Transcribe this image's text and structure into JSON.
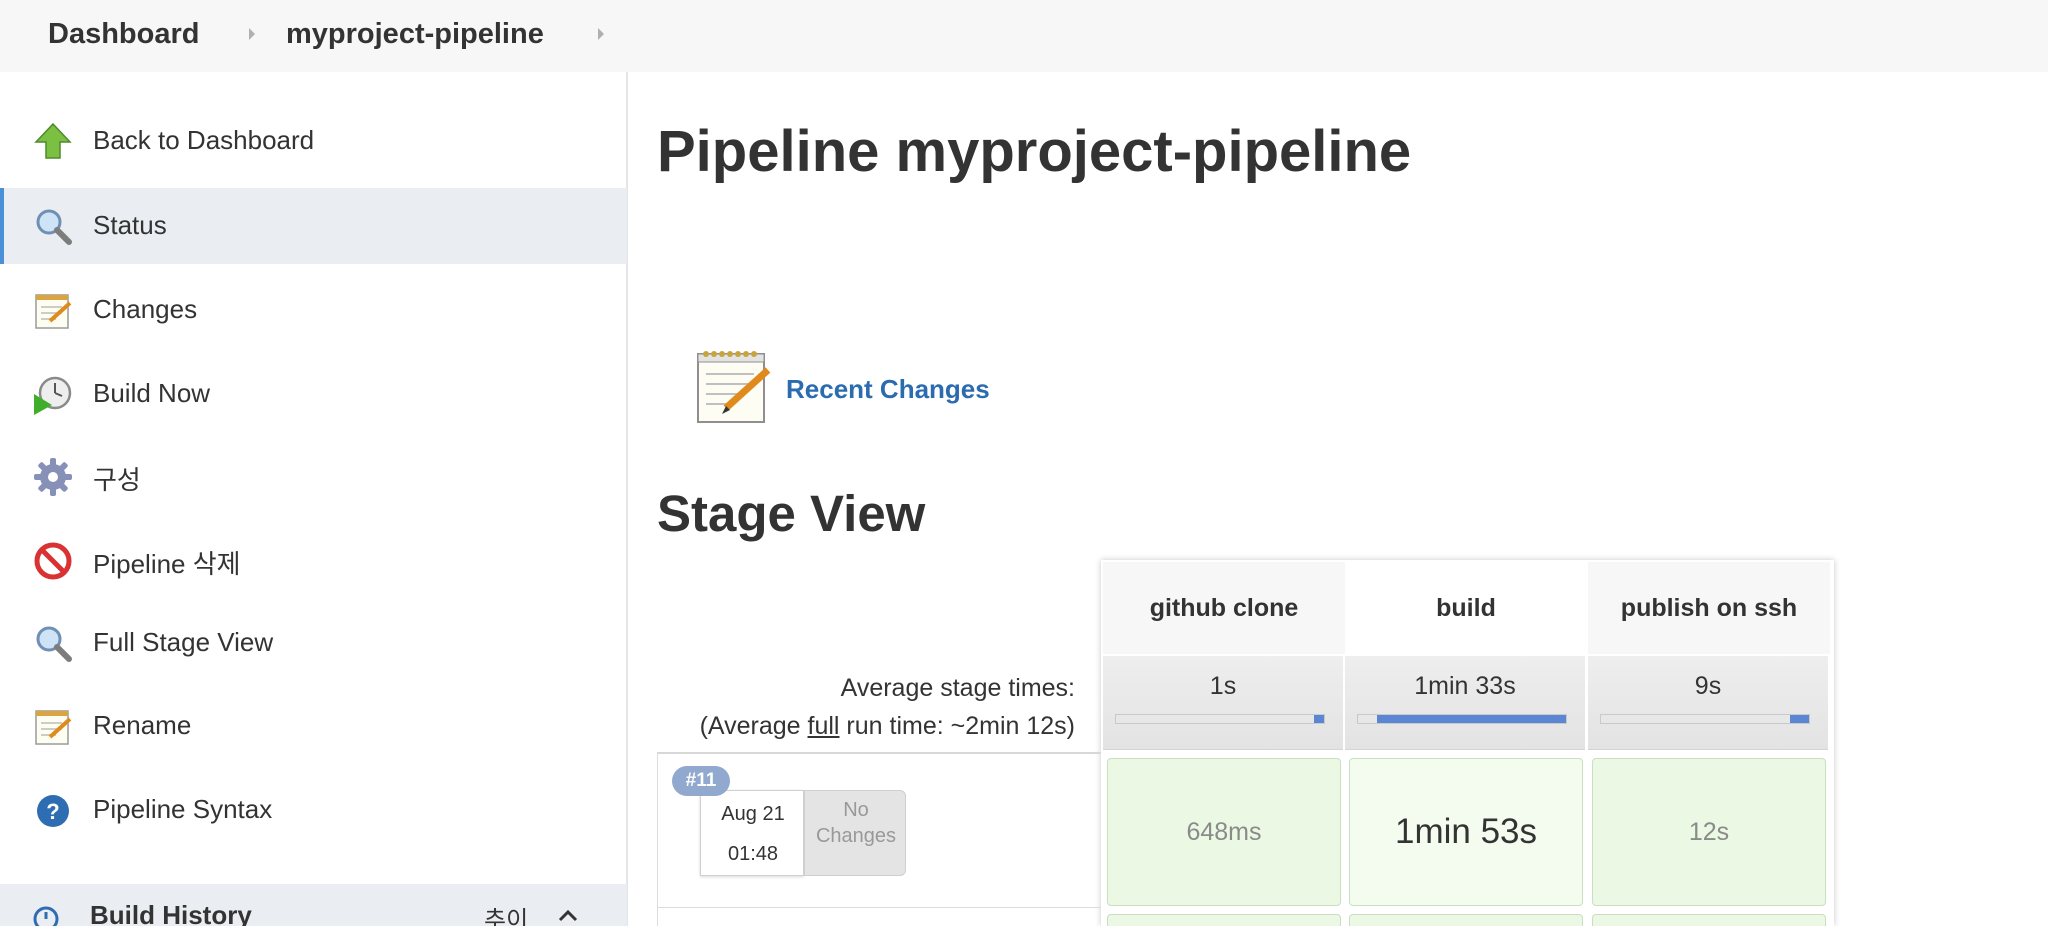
{
  "breadcrumb": {
    "items": [
      "Dashboard",
      "myproject-pipeline"
    ]
  },
  "sidebar": {
    "items": [
      {
        "label": "Back to Dashboard",
        "icon": "up-arrow-icon"
      },
      {
        "label": "Status",
        "icon": "magnifier-icon",
        "active": true
      },
      {
        "label": "Changes",
        "icon": "notepad-icon"
      },
      {
        "label": "Build Now",
        "icon": "clock-play-icon"
      },
      {
        "label": "구성",
        "icon": "gear-icon"
      },
      {
        "label": "Pipeline 삭제",
        "icon": "no-entry-icon"
      },
      {
        "label": "Full Stage View",
        "icon": "magnifier-icon"
      },
      {
        "label": "Rename",
        "icon": "notepad-icon"
      },
      {
        "label": "Pipeline Syntax",
        "icon": "help-icon"
      }
    ],
    "build_history": {
      "title": "Build History",
      "trend": "추이"
    }
  },
  "main": {
    "title": "Pipeline myproject-pipeline",
    "recent_changes": "Recent Changes",
    "stage_view_title": "Stage View"
  },
  "stage_view": {
    "avg_label": "Average stage times:",
    "avg_full_prefix": "(Average ",
    "avg_full_word": "full",
    "avg_full_suffix": " run time: ~2min 12s)",
    "stages": [
      {
        "name": "github clone",
        "avg": "1s",
        "avg_fraction": 0.05
      },
      {
        "name": "build",
        "avg": "1min 33s",
        "avg_fraction": 0.91
      },
      {
        "name": "publish on ssh",
        "avg": "9s",
        "avg_fraction": 0.09
      }
    ],
    "runs": [
      {
        "number": "#11",
        "date": "Aug 21",
        "time": "01:48",
        "changes": [
          "No",
          "Changes"
        ],
        "durations": [
          "648ms",
          "1min 53s",
          "12s"
        ]
      }
    ]
  },
  "colors": {
    "accent": "#4a90d9",
    "link": "#2b6bb0",
    "success_cell": "#ebf8e4",
    "progress": "#5b86d4",
    "badge": "#91a9cf"
  }
}
